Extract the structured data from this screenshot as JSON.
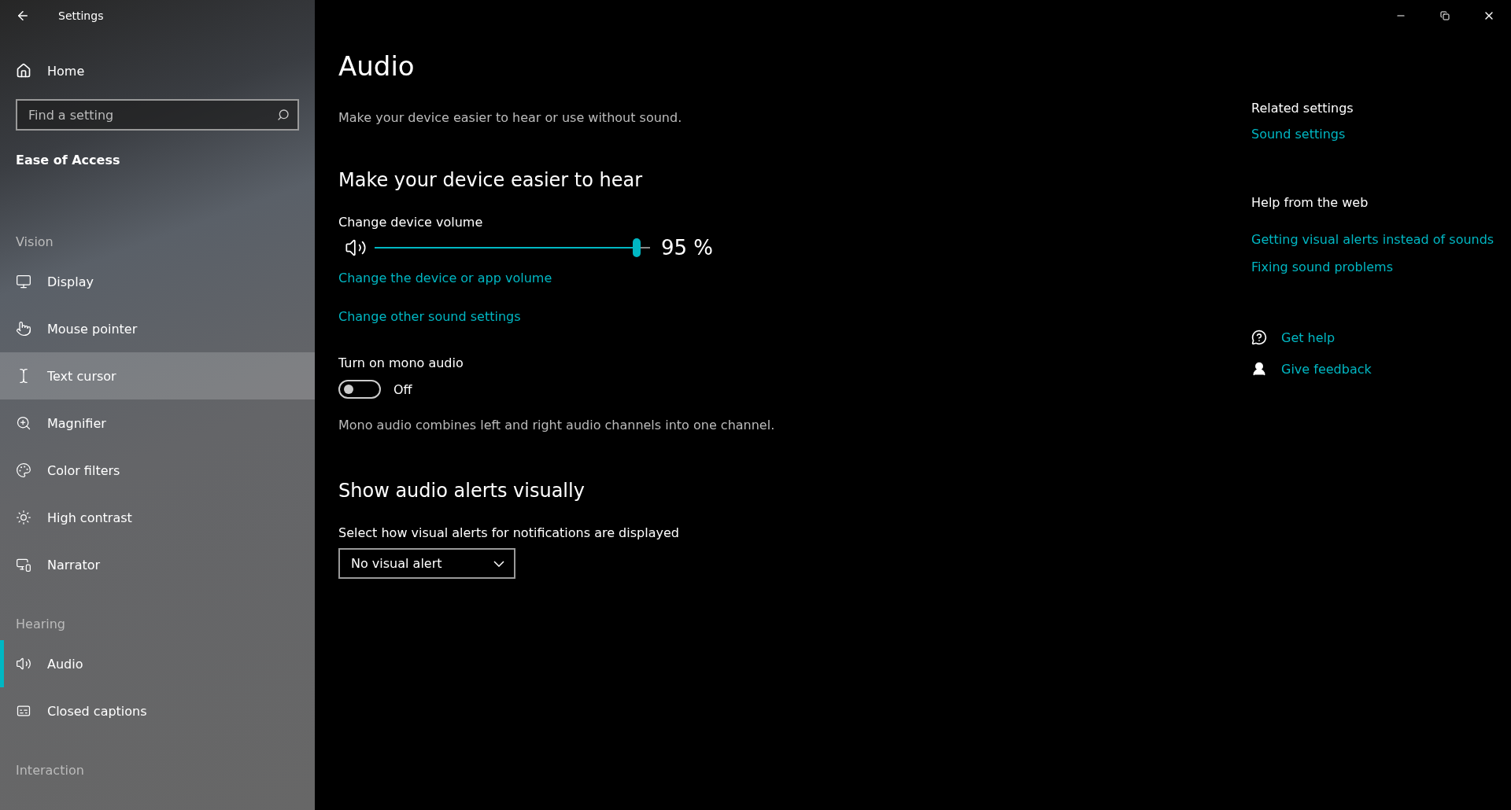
{
  "window": {
    "title": "Settings"
  },
  "sidebar": {
    "home": "Home",
    "search": {
      "placeholder": "Find a setting"
    },
    "category": "Ease of Access",
    "groups": [
      {
        "heading": "Vision",
        "items": [
          {
            "label": "Display",
            "selected": false,
            "hovered": false
          },
          {
            "label": "Mouse pointer",
            "selected": false,
            "hovered": false
          },
          {
            "label": "Text cursor",
            "selected": false,
            "hovered": true
          },
          {
            "label": "Magnifier",
            "selected": false,
            "hovered": false
          },
          {
            "label": "Color filters",
            "selected": false,
            "hovered": false
          },
          {
            "label": "High contrast",
            "selected": false,
            "hovered": false
          },
          {
            "label": "Narrator",
            "selected": false,
            "hovered": false
          }
        ]
      },
      {
        "heading": "Hearing",
        "items": [
          {
            "label": "Audio",
            "selected": true,
            "hovered": false
          },
          {
            "label": "Closed captions",
            "selected": false,
            "hovered": false
          }
        ]
      },
      {
        "heading": "Interaction"
      }
    ]
  },
  "page": {
    "title": "Audio",
    "description": "Make your device easier to hear or use without sound.",
    "hear_section": {
      "heading": "Make your device easier to hear",
      "volume_label": "Change device volume",
      "volume": {
        "level": 0.95,
        "reading": "95 %"
      },
      "links": [
        "Change the device or app volume",
        "Change other sound settings"
      ],
      "mono": {
        "label": "Turn on mono audio",
        "on": false,
        "state_text": "Off",
        "description": "Mono audio combines left and right audio channels into one channel."
      }
    },
    "alerts_section": {
      "heading": "Show audio alerts visually",
      "select_label": "Select how visual alerts for notifications are displayed",
      "select_value": "No visual alert"
    }
  },
  "aside": {
    "related_heading": "Related settings",
    "related_links": [
      "Sound settings"
    ],
    "web_heading": "Help from the web",
    "web_links": [
      "Getting visual alerts instead of sounds",
      "Fixing sound problems"
    ],
    "actions": [
      "Get help",
      "Give feedback"
    ]
  }
}
